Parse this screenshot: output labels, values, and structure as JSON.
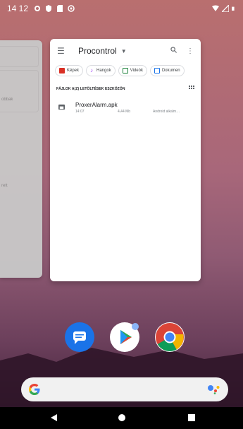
{
  "status_bar": {
    "time": "14 12",
    "left_icons": [
      "settings-icon",
      "shield-icon",
      "sd-card-icon",
      "vpn-icon"
    ],
    "right_icons": [
      "wifi-icon",
      "signal-icon",
      "battery-icon"
    ]
  },
  "prev_card": {
    "text1": "obbak",
    "text2": "rett"
  },
  "app_card": {
    "title": "Procontrol",
    "chips": [
      {
        "label": "Képek",
        "color": "#d93025"
      },
      {
        "label": "Hangok",
        "color": "#a142f4"
      },
      {
        "label": "Videók",
        "color": "#188038"
      },
      {
        "label": "Dokumen",
        "color": "#1a73e8"
      }
    ],
    "section_label": "FÁJLOK A(Z) LETÖLTÉSEK ESZKÖZÖN",
    "file": {
      "name": "ProxerAlarm.apk",
      "date": "14:07",
      "size": "4,44 Mb",
      "type": "Android alkalm…"
    }
  },
  "dock": [
    "messages-icon",
    "play-store-icon",
    "chrome-icon"
  ],
  "search_bar": {
    "logo": "google-g-icon",
    "assistant": "assistant-icon"
  },
  "nav": [
    "back-button",
    "home-button",
    "recents-button"
  ]
}
